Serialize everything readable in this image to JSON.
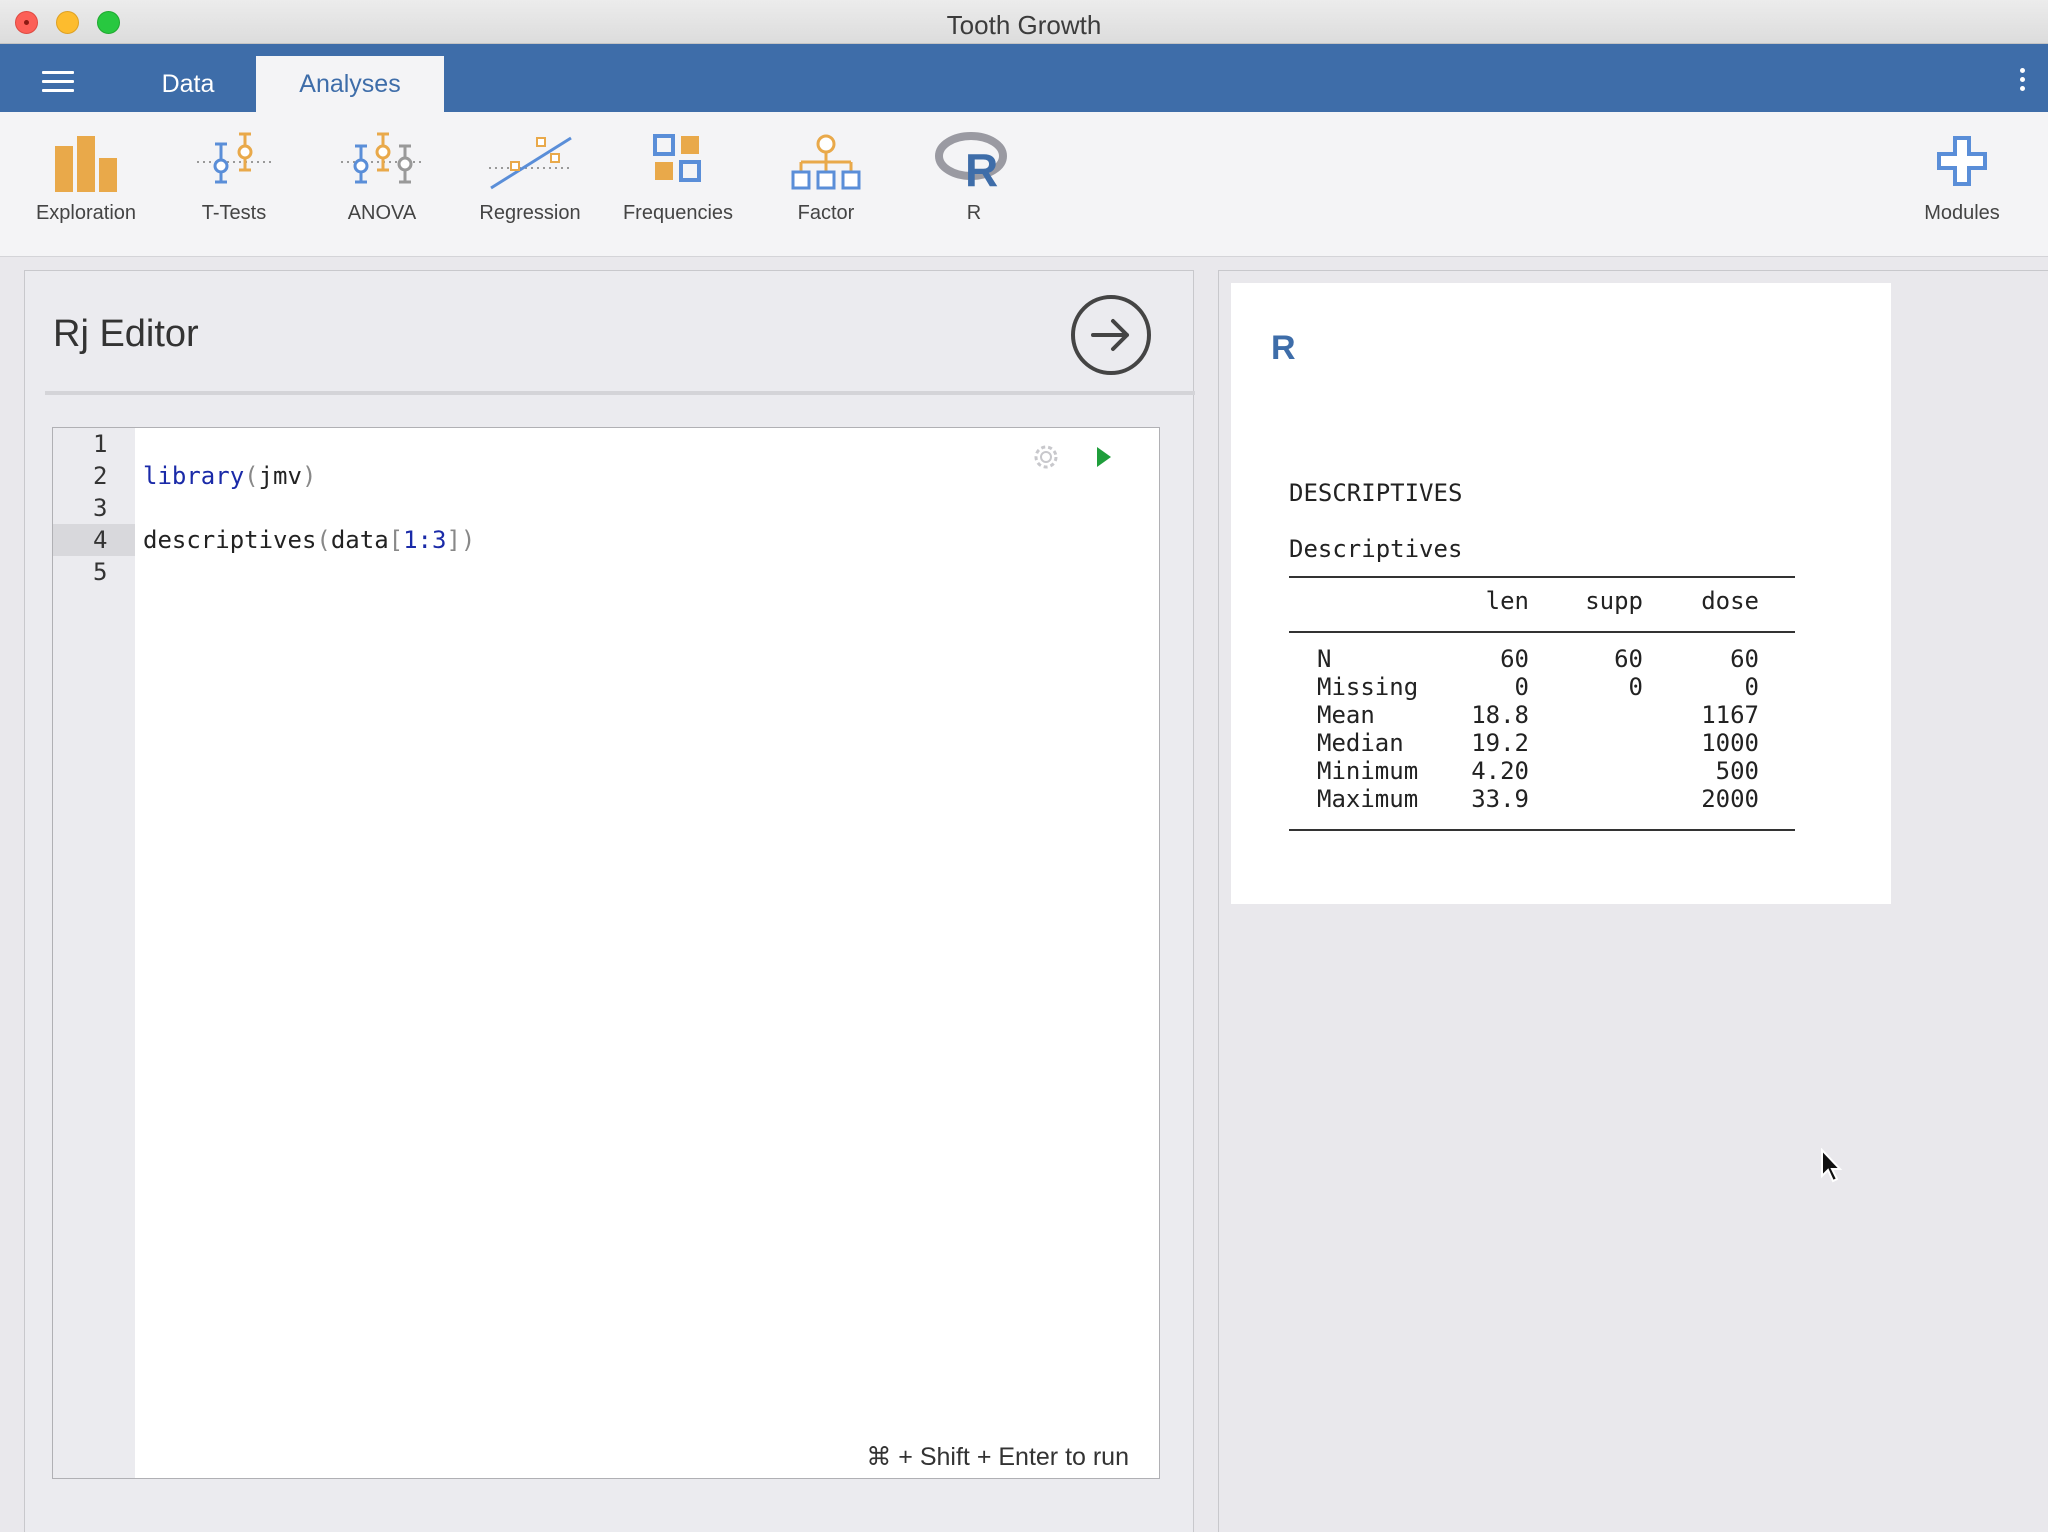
{
  "window": {
    "title": "Tooth Growth"
  },
  "tabs": [
    {
      "label": "Data",
      "active": false
    },
    {
      "label": "Analyses",
      "active": true
    }
  ],
  "ribbon": {
    "exploration": "Exploration",
    "ttests": "T-Tests",
    "anova": "ANOVA",
    "regression": "Regression",
    "frequencies": "Frequencies",
    "factor": "Factor",
    "r": "R",
    "modules": "Modules"
  },
  "editor": {
    "title": "Rj Editor",
    "line_numbers": [
      "1",
      "2",
      "3",
      "4",
      "5"
    ],
    "active_line": 4,
    "code": {
      "line2_fn": "library",
      "line2_open": "(",
      "line2_arg": "jmv",
      "line2_close": ")",
      "line4_fn": "descriptives",
      "line4_open": "(",
      "line4_arg": "data",
      "line4_bopen": "[",
      "line4_range": "1:3",
      "line4_bclose": "]",
      "line4_close": ")"
    },
    "run_hint": "⌘ + Shift + Enter to run"
  },
  "results": {
    "title": "R",
    "heading": "DESCRIPTIVES",
    "subheading": "Descriptives",
    "columns": [
      "",
      "len",
      "supp",
      "dose"
    ],
    "rows": [
      {
        "label": "N",
        "len": "60",
        "supp": "60",
        "dose": "60"
      },
      {
        "label": "Missing",
        "len": "0",
        "supp": "0",
        "dose": "0"
      },
      {
        "label": "Mean",
        "len": "18.8",
        "supp": "",
        "dose": "1167"
      },
      {
        "label": "Median",
        "len": "19.2",
        "supp": "",
        "dose": "1000"
      },
      {
        "label": "Minimum",
        "len": "4.20",
        "supp": "",
        "dose": "500"
      },
      {
        "label": "Maximum",
        "len": "33.9",
        "supp": "",
        "dose": "2000"
      }
    ]
  },
  "colors": {
    "accent": "#3e6da9",
    "icon_orange": "#e9a94a",
    "icon_blue": "#5a8ed8",
    "run_green": "#1f9e3b"
  }
}
